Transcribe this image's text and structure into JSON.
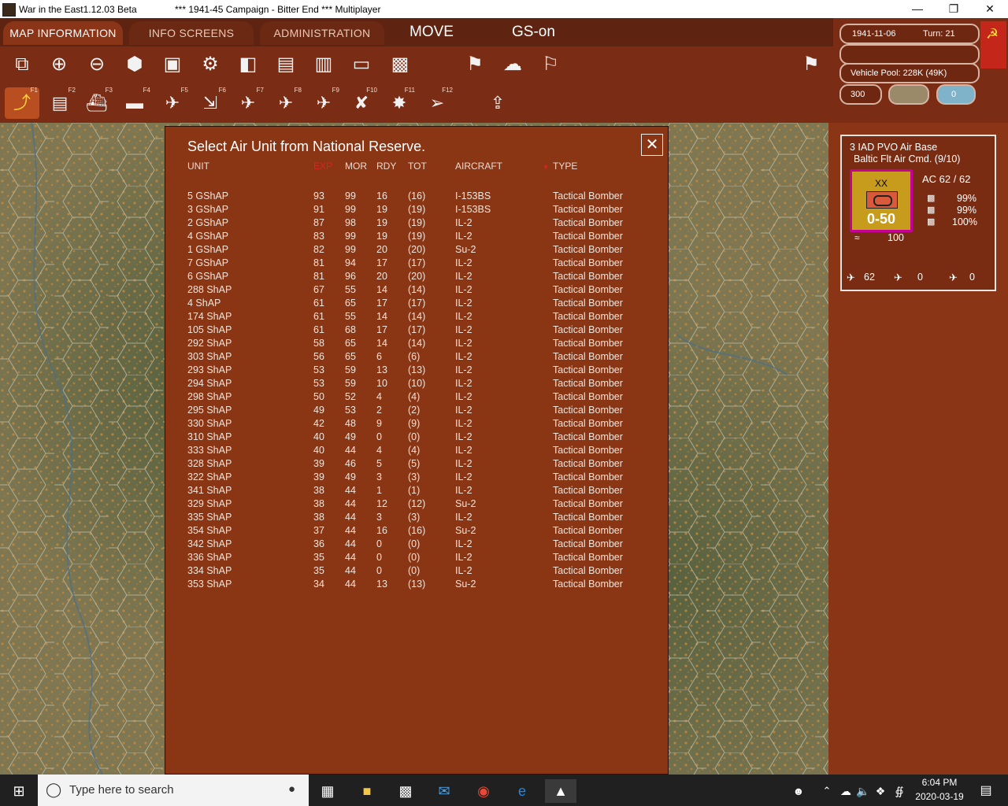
{
  "window": {
    "title": "War in the East1.12.03 Beta",
    "subtitle": "***   1941-45 Campaign - Bitter End   ***   Multiplayer"
  },
  "tabs": [
    {
      "label": "MAP INFORMATION"
    },
    {
      "label": "INFO SCREENS"
    },
    {
      "label": "ADMINISTRATION"
    }
  ],
  "mode": {
    "move": "MOVE",
    "gs": "GS-on"
  },
  "status": {
    "date": "1941-11-06",
    "turn": "Turn: 21",
    "vehicle_pool": "Vehicle Pool: 228K (49K)",
    "points": "300",
    "counter_value": "0"
  },
  "toolbar_row1": [
    "windows-icon",
    "zoom-in-icon",
    "zoom-out-icon",
    "hexes-icon",
    "frame-icon",
    "gear-icon",
    "unit-icon",
    "display-icon",
    "factory-icon",
    "rectangle-icon",
    "overlay-icon",
    "flag-icon",
    "weather-icon",
    "pennant-icon"
  ],
  "fkeys": [
    "F1",
    "F2",
    "F3",
    "F4",
    "F5",
    "F6",
    "F7",
    "F8",
    "F9",
    "F10",
    "F11",
    "F12"
  ],
  "unit_card": {
    "name": "3 IAD PVO Air Base",
    "hq": "Baltic Flt Air Cmd. (9/10)",
    "ac": "AC  62 / 62",
    "counter_type": "XX",
    "counter_strength": "0-50",
    "pct1": "99%",
    "pct2": "99%",
    "pct3": "100%",
    "supply": "100",
    "air1": "62",
    "air2": "0",
    "air3": "0"
  },
  "dialog": {
    "title": "Select Air Unit from National Reserve.",
    "columns": {
      "unit": "UNIT",
      "exp": "EXP",
      "mor": "MOR",
      "rdy": "RDY",
      "tot": "TOT",
      "aircraft": "AIRCRAFT",
      "type": "TYPE"
    },
    "sort_marker": "▼",
    "rows": [
      {
        "unit": "5 GShAP",
        "exp": "93",
        "mor": "99",
        "rdy": "16",
        "tot": "(16)",
        "aircraft": "I-153BS",
        "type": "Tactical Bomber"
      },
      {
        "unit": "3 GShAP",
        "exp": "91",
        "mor": "99",
        "rdy": "19",
        "tot": "(19)",
        "aircraft": "I-153BS",
        "type": "Tactical Bomber"
      },
      {
        "unit": "2 GShAP",
        "exp": "87",
        "mor": "98",
        "rdy": "19",
        "tot": "(19)",
        "aircraft": "IL-2",
        "type": "Tactical Bomber"
      },
      {
        "unit": "4 GShAP",
        "exp": "83",
        "mor": "99",
        "rdy": "19",
        "tot": "(19)",
        "aircraft": "IL-2",
        "type": "Tactical Bomber"
      },
      {
        "unit": "1 GShAP",
        "exp": "82",
        "mor": "99",
        "rdy": "20",
        "tot": "(20)",
        "aircraft": "Su-2",
        "type": "Tactical Bomber"
      },
      {
        "unit": "7 GShAP",
        "exp": "81",
        "mor": "94",
        "rdy": "17",
        "tot": "(17)",
        "aircraft": "IL-2",
        "type": "Tactical Bomber"
      },
      {
        "unit": "6 GShAP",
        "exp": "81",
        "mor": "96",
        "rdy": "20",
        "tot": "(20)",
        "aircraft": "IL-2",
        "type": "Tactical Bomber"
      },
      {
        "unit": "288 ShAP",
        "exp": "67",
        "mor": "55",
        "rdy": "14",
        "tot": "(14)",
        "aircraft": "IL-2",
        "type": "Tactical Bomber"
      },
      {
        "unit": "4 ShAP",
        "exp": "61",
        "mor": "65",
        "rdy": "17",
        "tot": "(17)",
        "aircraft": "IL-2",
        "type": "Tactical Bomber"
      },
      {
        "unit": "174 ShAP",
        "exp": "61",
        "mor": "55",
        "rdy": "14",
        "tot": "(14)",
        "aircraft": "IL-2",
        "type": "Tactical Bomber"
      },
      {
        "unit": "105 ShAP",
        "exp": "61",
        "mor": "68",
        "rdy": "17",
        "tot": "(17)",
        "aircraft": "IL-2",
        "type": "Tactical Bomber"
      },
      {
        "unit": "292 ShAP",
        "exp": "58",
        "mor": "65",
        "rdy": "14",
        "tot": "(14)",
        "aircraft": "IL-2",
        "type": "Tactical Bomber"
      },
      {
        "unit": "303 ShAP",
        "exp": "56",
        "mor": "65",
        "rdy": "6",
        "tot": "(6)",
        "aircraft": "IL-2",
        "type": "Tactical Bomber"
      },
      {
        "unit": "293 ShAP",
        "exp": "53",
        "mor": "59",
        "rdy": "13",
        "tot": "(13)",
        "aircraft": "IL-2",
        "type": "Tactical Bomber"
      },
      {
        "unit": "294 ShAP",
        "exp": "53",
        "mor": "59",
        "rdy": "10",
        "tot": "(10)",
        "aircraft": "IL-2",
        "type": "Tactical Bomber"
      },
      {
        "unit": "298 ShAP",
        "exp": "50",
        "mor": "52",
        "rdy": "4",
        "tot": "(4)",
        "aircraft": "IL-2",
        "type": "Tactical Bomber"
      },
      {
        "unit": "295 ShAP",
        "exp": "49",
        "mor": "53",
        "rdy": "2",
        "tot": "(2)",
        "aircraft": "IL-2",
        "type": "Tactical Bomber"
      },
      {
        "unit": "330 ShAP",
        "exp": "42",
        "mor": "48",
        "rdy": "9",
        "tot": "(9)",
        "aircraft": "IL-2",
        "type": "Tactical Bomber"
      },
      {
        "unit": "310 ShAP",
        "exp": "40",
        "mor": "49",
        "rdy": "0",
        "tot": "(0)",
        "aircraft": "IL-2",
        "type": "Tactical Bomber"
      },
      {
        "unit": "333 ShAP",
        "exp": "40",
        "mor": "44",
        "rdy": "4",
        "tot": "(4)",
        "aircraft": "IL-2",
        "type": "Tactical Bomber"
      },
      {
        "unit": "328 ShAP",
        "exp": "39",
        "mor": "46",
        "rdy": "5",
        "tot": "(5)",
        "aircraft": "IL-2",
        "type": "Tactical Bomber"
      },
      {
        "unit": "322 ShAP",
        "exp": "39",
        "mor": "49",
        "rdy": "3",
        "tot": "(3)",
        "aircraft": "IL-2",
        "type": "Tactical Bomber"
      },
      {
        "unit": "341 ShAP",
        "exp": "38",
        "mor": "44",
        "rdy": "1",
        "tot": "(1)",
        "aircraft": "IL-2",
        "type": "Tactical Bomber"
      },
      {
        "unit": "329 ShAP",
        "exp": "38",
        "mor": "44",
        "rdy": "12",
        "tot": "(12)",
        "aircraft": "Su-2",
        "type": "Tactical Bomber"
      },
      {
        "unit": "335 ShAP",
        "exp": "38",
        "mor": "44",
        "rdy": "3",
        "tot": "(3)",
        "aircraft": "IL-2",
        "type": "Tactical Bomber"
      },
      {
        "unit": "354 ShAP",
        "exp": "37",
        "mor": "44",
        "rdy": "16",
        "tot": "(16)",
        "aircraft": "Su-2",
        "type": "Tactical Bomber"
      },
      {
        "unit": "342 ShAP",
        "exp": "36",
        "mor": "44",
        "rdy": "0",
        "tot": "(0)",
        "aircraft": "IL-2",
        "type": "Tactical Bomber"
      },
      {
        "unit": "336 ShAP",
        "exp": "35",
        "mor": "44",
        "rdy": "0",
        "tot": "(0)",
        "aircraft": "IL-2",
        "type": "Tactical Bomber"
      },
      {
        "unit": "334 ShAP",
        "exp": "35",
        "mor": "44",
        "rdy": "0",
        "tot": "(0)",
        "aircraft": "IL-2",
        "type": "Tactical Bomber"
      },
      {
        "unit": "353 ShAP",
        "exp": "34",
        "mor": "44",
        "rdy": "13",
        "tot": "(13)",
        "aircraft": "Su-2",
        "type": "Tactical Bomber"
      }
    ]
  },
  "taskbar": {
    "search_placeholder": "Type here to search",
    "time": "6:04 PM",
    "date": "2020-03-19"
  },
  "colors": {
    "panel": "#8a3514",
    "topbar": "#7a2c14",
    "exp_header": "#dd2222",
    "counter_border": "#c8009a"
  }
}
